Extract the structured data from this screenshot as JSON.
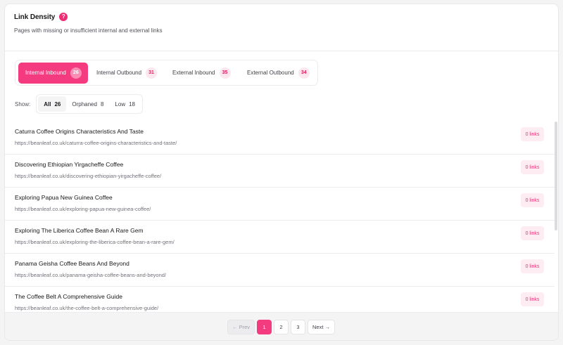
{
  "header": {
    "title": "Link Density",
    "help_icon": "?",
    "subtitle": "Pages with missing or insufficient internal and external links"
  },
  "tabs": [
    {
      "label": "Internal Inbound",
      "count": "26",
      "active": true
    },
    {
      "label": "Internal Outbound",
      "count": "31",
      "active": false
    },
    {
      "label": "External Inbound",
      "count": "35",
      "active": false
    },
    {
      "label": "External Outbound",
      "count": "34",
      "active": false
    }
  ],
  "show": {
    "label": "Show:",
    "filters": [
      {
        "label": "All",
        "count": "26",
        "active": true
      },
      {
        "label": "Orphaned",
        "count": "8",
        "active": false
      },
      {
        "label": "Low",
        "count": "18",
        "active": false
      }
    ]
  },
  "pages": [
    {
      "title": "Caturra Coffee Origins Characteristics And Taste",
      "url": "https://beanleaf.co.uk/caturra-coffee-origins-characteristics-and-taste/",
      "links": "0 links"
    },
    {
      "title": "Discovering Ethiopian Yirgacheffe Coffee",
      "url": "https://beanleaf.co.uk/discovering-ethiopian-yirgacheffe-coffee/",
      "links": "0 links"
    },
    {
      "title": "Exploring Papua New Guinea Coffee",
      "url": "https://beanleaf.co.uk/exploring-papua-new-guinea-coffee/",
      "links": "0 links"
    },
    {
      "title": "Exploring The Liberica Coffee Bean A Rare Gem",
      "url": "https://beanleaf.co.uk/exploring-the-liberica-coffee-bean-a-rare-gem/",
      "links": "0 links"
    },
    {
      "title": "Panama Geisha Coffee Beans And Beyond",
      "url": "https://beanleaf.co.uk/panama-geisha-coffee-beans-and-beyond/",
      "links": "0 links"
    },
    {
      "title": "The Coffee Belt A Comprehensive Guide",
      "url": "https://beanleaf.co.uk/the-coffee-belt-a-comprehensive-guide/",
      "links": "0 links"
    }
  ],
  "pagination": {
    "prev": "← Prev",
    "pages": [
      "1",
      "2",
      "3"
    ],
    "current": "1",
    "next": "Next →"
  },
  "colors": {
    "accent": "#f43b7f",
    "badge_bg": "#fdecf2",
    "badge_text": "#ef2d74"
  }
}
